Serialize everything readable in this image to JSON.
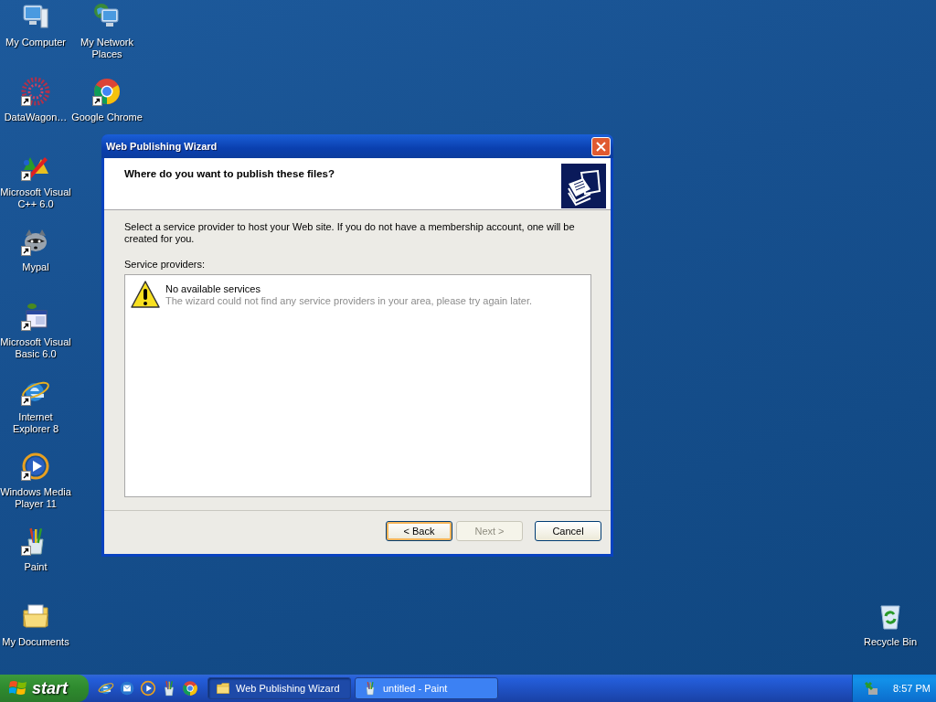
{
  "desktop_icons": [
    {
      "label": "My Computer",
      "kind": "computer",
      "shortcut": false
    },
    {
      "label": "My Network Places",
      "kind": "network",
      "shortcut": false
    },
    {
      "label": "DataWagon…",
      "kind": "dots",
      "shortcut": true
    },
    {
      "label": "Google Chrome",
      "kind": "chrome",
      "shortcut": true
    },
    {
      "label": "Microsoft Visual C++ 6.0",
      "kind": "vcpp",
      "shortcut": true
    },
    {
      "label": "Mypal",
      "kind": "raccoon",
      "shortcut": true
    },
    {
      "label": "Microsoft Visual Basic 6.0",
      "kind": "vb",
      "shortcut": true
    },
    {
      "label": "Internet Explorer 8",
      "kind": "ie",
      "shortcut": true
    },
    {
      "label": "Windows Media Player 11",
      "kind": "wmp",
      "shortcut": true
    },
    {
      "label": "Paint",
      "kind": "paint",
      "shortcut": true
    },
    {
      "label": "My Documents",
      "kind": "documents",
      "shortcut": false
    },
    {
      "label": "Recycle Bin",
      "kind": "recycle",
      "shortcut": false
    }
  ],
  "window": {
    "title": "Web Publishing Wizard",
    "heading": "Where do you want to publish these files?",
    "intro": "Select a service provider to host your Web site.  If you do not have a membership account, one will be created for you.",
    "list_label": "Service providers:",
    "message": {
      "title": "No available services",
      "detail": "The wizard could not find any service providers in your area, please try again later."
    },
    "buttons": [
      {
        "label": "< Back",
        "disabled": false,
        "focused": true
      },
      {
        "label": "Next >",
        "disabled": true,
        "focused": false
      },
      {
        "label": "Cancel",
        "disabled": false,
        "focused": false
      }
    ]
  },
  "taskbar": {
    "start": "start",
    "quick_launch": [
      {
        "kind": "ie"
      },
      {
        "kind": "mail"
      },
      {
        "kind": "wmp"
      },
      {
        "kind": "paint"
      },
      {
        "kind": "chrome"
      }
    ],
    "tasks": [
      {
        "label": "Web Publishing Wizard",
        "kind": "folder",
        "selected": true
      },
      {
        "label": "untitled - Paint",
        "kind": "paint",
        "selected": false
      }
    ],
    "clock": "8:57 PM"
  }
}
